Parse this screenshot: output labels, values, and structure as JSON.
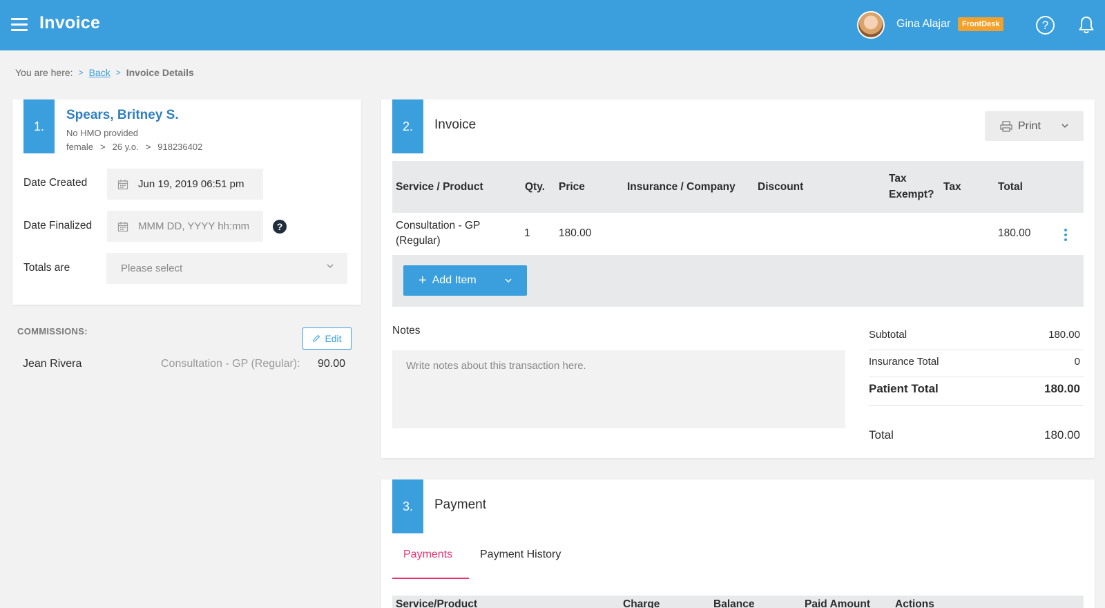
{
  "header": {
    "title": "Invoice",
    "user_name": "Gina Alajar",
    "role": "FrontDesk",
    "help_glyph": "?"
  },
  "breadcrumb": {
    "prefix": "You are here:",
    "back": "Back",
    "current": "Invoice Details",
    "sep": ">"
  },
  "patient": {
    "step": "1.",
    "name": "Spears, Britney S.",
    "hmo": "No HMO provided",
    "gender": "female",
    "age": "26 y.o.",
    "phone": "918236402",
    "sep": ">",
    "date_created_label": "Date Created",
    "date_created_value": "Jun 19, 2019 06:51 pm",
    "date_finalized_label": "Date Finalized",
    "date_finalized_placeholder": "MMM DD, YYYY hh:mm",
    "totals_label": "Totals are",
    "totals_placeholder": "Please select",
    "help_glyph": "?"
  },
  "commissions": {
    "label": "COMMISSIONS:",
    "edit": "Edit",
    "person": "Jean Rivera",
    "service": "Consultation - GP (Regular):",
    "amount": "90.00"
  },
  "invoice": {
    "step": "2.",
    "title": "Invoice",
    "print": "Print",
    "columns": {
      "service": "Service / Product",
      "qty": "Qty.",
      "price": "Price",
      "insurance": "Insurance / Company",
      "discount": "Discount",
      "tax_exempt_1": "Tax",
      "tax_exempt_2": "Exempt?",
      "tax": "Tax",
      "total": "Total"
    },
    "row": {
      "service_1": "Consultation - GP",
      "service_2": "(Regular)",
      "qty": "1",
      "price": "180.00",
      "total": "180.00"
    },
    "add_item": "Add Item",
    "add_plus": "+",
    "notes_label": "Notes",
    "notes_placeholder": "Write notes about this transaction here.",
    "summary": {
      "subtotal_label": "Subtotal",
      "subtotal": "180.00",
      "insurance_label": "Insurance Total",
      "insurance": "0",
      "patient_label": "Patient Total",
      "patient": "180.00",
      "total_label": "Total",
      "total": "180.00"
    }
  },
  "payment": {
    "step": "3.",
    "title": "Payment",
    "tabs": [
      "Payments",
      "Payment History"
    ],
    "columns": [
      "Service/Product",
      "Charge",
      "Balance",
      "Paid Amount",
      "Actions"
    ]
  },
  "colors": {
    "primary": "#3a9fdc",
    "badge": "#f4a12c",
    "tab_active": "#e8336f"
  },
  "icons": [
    "menu-icon",
    "help-circle-icon",
    "bell-icon",
    "calendar-icon",
    "question-icon",
    "chevron-down-icon",
    "pencil-icon",
    "printer-icon",
    "plus-icon",
    "kebab-icon"
  ]
}
